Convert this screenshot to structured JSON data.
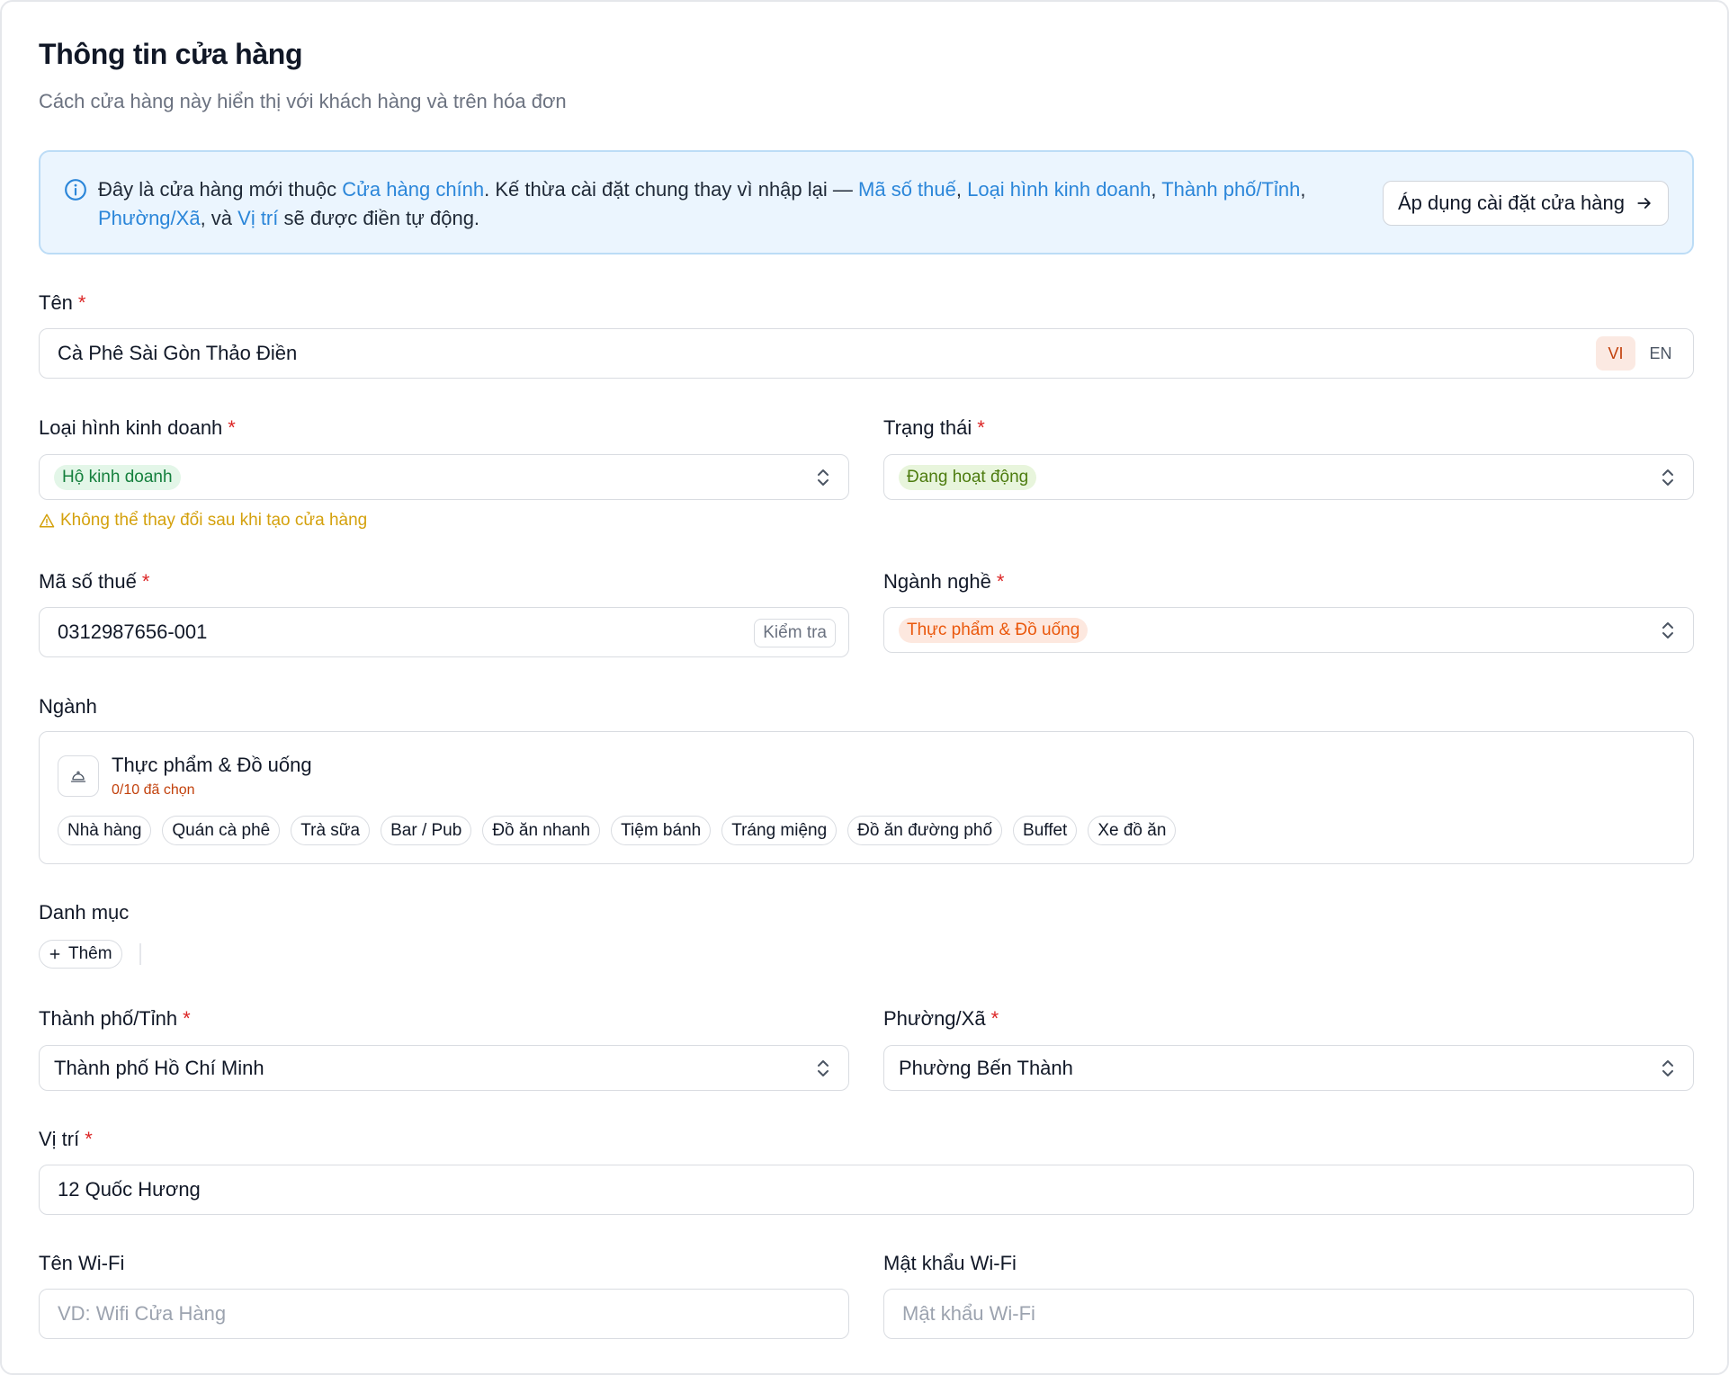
{
  "header": {
    "title": "Thông tin cửa hàng",
    "subtitle": "Cách cửa hàng này hiển thị với khách hàng và trên hóa đơn"
  },
  "banner": {
    "text_1": "Đây là cửa hàng mới thuộc ",
    "link_parent": "Cửa hàng chính",
    "text_2": ". Kế thừa cài đặt chung thay vì nhập lại — ",
    "link_tax": "Mã số thuế",
    "sep_1": ", ",
    "link_business_type": "Loại hình kinh doanh",
    "sep_2": ", ",
    "link_city": "Thành phố/Tỉnh",
    "sep_3": ", ",
    "link_ward": "Phường/Xã",
    "sep_4": ", và ",
    "link_location": "Vị trí",
    "text_3": " sẽ được điền tự động.",
    "apply_label": "Áp dụng cài đặt cửa hàng"
  },
  "name": {
    "label": "Tên",
    "required": "*",
    "value": "Cà Phê Sài Gòn Thảo Điền",
    "lang_vi": "VI",
    "lang_en": "EN",
    "active_lang": "VI"
  },
  "business_type": {
    "label": "Loại hình kinh doanh",
    "required": "*",
    "value": "Hộ kinh doanh",
    "warning": "Không thể thay đổi sau khi tạo cửa hàng"
  },
  "status": {
    "label": "Trạng thái",
    "required": "*",
    "value": "Đang hoạt động"
  },
  "tax": {
    "label": "Mã số thuế",
    "required": "*",
    "value": "0312987656-001",
    "check_label": "Kiểm tra"
  },
  "sector": {
    "label": "Ngành nghề",
    "required": "*",
    "value": "Thực phẩm & Đồ uống"
  },
  "industry": {
    "label": "Ngành",
    "group_name": "Thực phẩm & Đồ uống",
    "selected_count": "0/10 đã chọn",
    "chips": [
      "Nhà hàng",
      "Quán cà phê",
      "Trà sữa",
      "Bar / Pub",
      "Đồ ăn nhanh",
      "Tiệm bánh",
      "Tráng miệng",
      "Đồ ăn đường phố",
      "Buffet",
      "Xe đồ ăn"
    ]
  },
  "category": {
    "label": "Danh mục",
    "add_label": "Thêm"
  },
  "city": {
    "label": "Thành phố/Tỉnh",
    "required": "*",
    "value": "Thành phố Hồ Chí Minh"
  },
  "ward": {
    "label": "Phường/Xã",
    "required": "*",
    "value": "Phường Bến Thành"
  },
  "location": {
    "label": "Vị trí",
    "required": "*",
    "value": "12 Quốc Hương"
  },
  "wifi": {
    "name_label": "Tên Wi-Fi",
    "name_placeholder": "VD: Wifi Cửa Hàng",
    "password_label": "Mật khẩu Wi-Fi",
    "password_placeholder": "Mật khẩu Wi-Fi"
  },
  "colors": {
    "link": "#2b86d9",
    "required": "#dc2626",
    "warning": "#d4a10d",
    "banner_bg": "#ebf5fe"
  },
  "icons": {
    "info": "info-circle-icon",
    "arrow": "arrow-right-icon",
    "chevron": "chevron-up-down-icon",
    "warning": "warning-triangle-icon",
    "industry": "cloche-icon",
    "plus": "plus-icon"
  }
}
